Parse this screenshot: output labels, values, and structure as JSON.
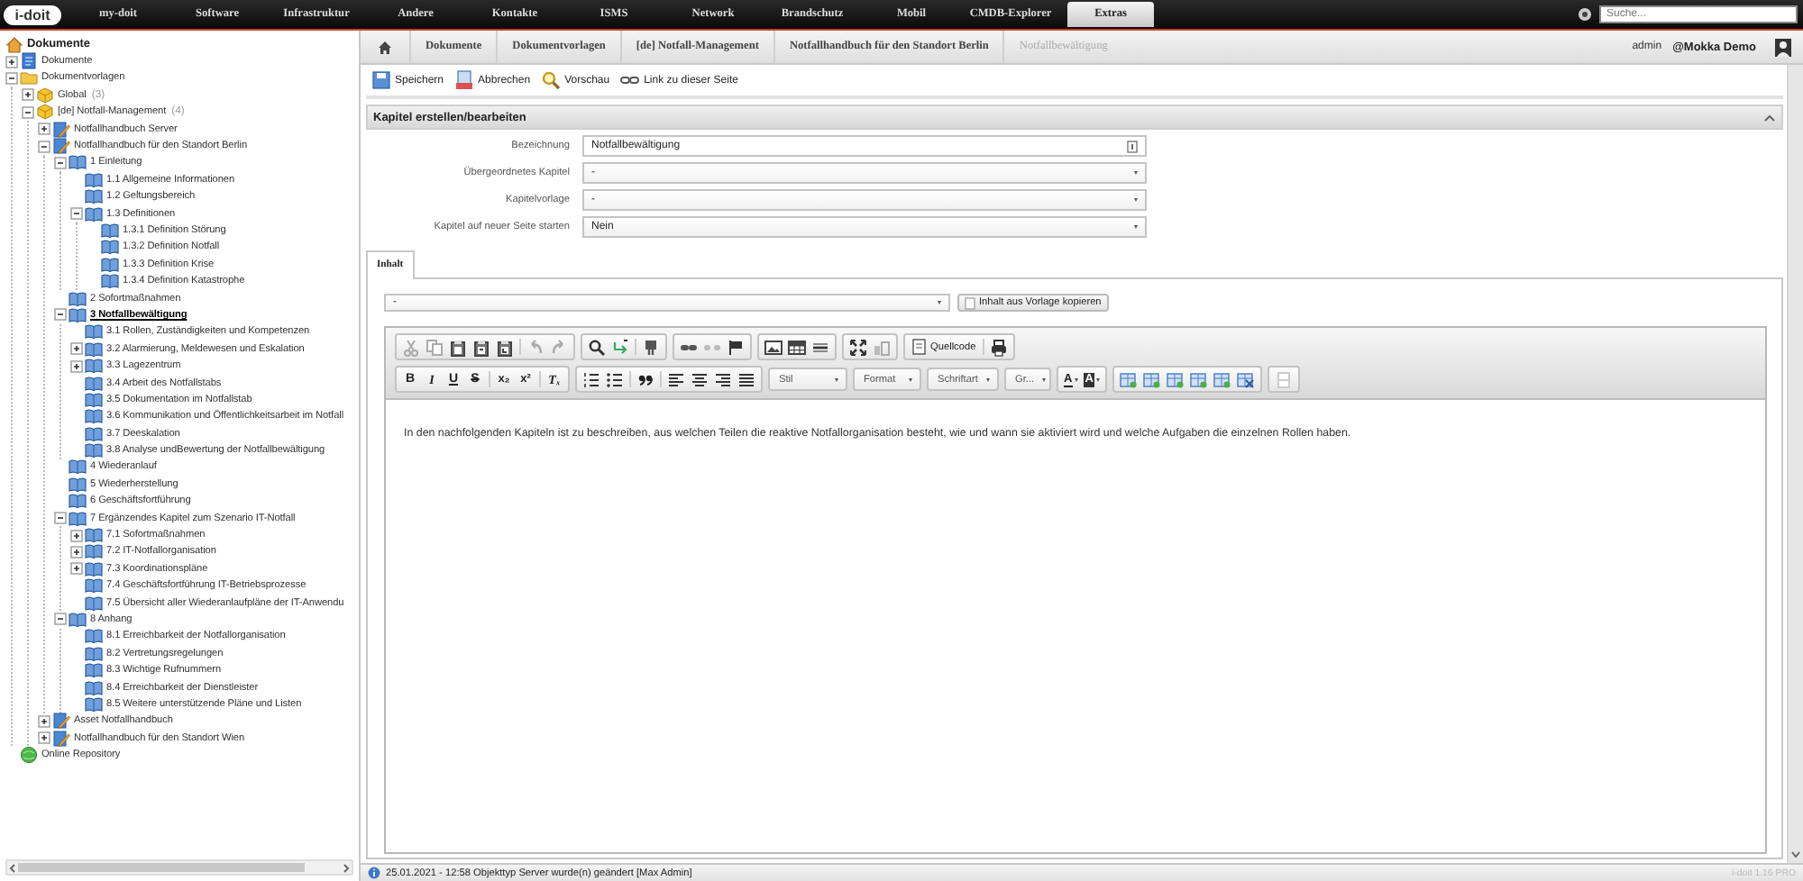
{
  "nav": {
    "logo": "i-doit",
    "items": [
      {
        "label": "my-doit",
        "selected": false
      },
      {
        "label": "Software",
        "selected": false
      },
      {
        "label": "Infrastruktur",
        "selected": false
      },
      {
        "label": "Andere",
        "selected": false
      },
      {
        "label": "Kontakte",
        "selected": false
      },
      {
        "label": "ISMS",
        "selected": false
      },
      {
        "label": "Network",
        "selected": false
      },
      {
        "label": "Brandschutz",
        "selected": false
      },
      {
        "label": "Mobil",
        "selected": false
      },
      {
        "label": "CMDB-Explorer",
        "selected": false
      },
      {
        "label": "Extras",
        "selected": true
      }
    ],
    "search": {
      "placeholder": "Suche..."
    }
  },
  "tree": {
    "items": [
      {
        "label": "Dokumente",
        "kind": "home",
        "selected": false,
        "children": [
          {
            "label": "Dokumente",
            "kind": "document",
            "expanded": false,
            "selected": false
          },
          {
            "label": "Dokumentvorlagen",
            "kind": "folder",
            "expanded": true,
            "selected": false,
            "children": [
              {
                "label": "Global",
                "count": "(3)",
                "kind": "package",
                "expanded": false,
                "selected": false
              },
              {
                "label": "[de] Notfall-Management",
                "count": "(4)",
                "kind": "package",
                "expanded": true,
                "selected": false,
                "children": [
                  {
                    "label": "Notfallhandbuch Server",
                    "kind": "manual",
                    "expanded": false,
                    "selected": false
                  },
                  {
                    "label": "Notfallhandbuch für den Standort Berlin",
                    "kind": "manual",
                    "expanded": true,
                    "selected": false,
                    "children": [
                      {
                        "label": "1 Einleitung",
                        "kind": "chapter",
                        "expanded": true,
                        "selected": false,
                        "children": [
                          {
                            "label": "1.1 Allgemeine Informationen",
                            "kind": "chapter",
                            "selected": false
                          },
                          {
                            "label": "1.2 Geltungsbereich",
                            "kind": "chapter",
                            "selected": false
                          },
                          {
                            "label": "1.3 Definitionen",
                            "kind": "chapter",
                            "expanded": true,
                            "selected": false,
                            "children": [
                              {
                                "label": "1.3.1 Definition Störung",
                                "kind": "chapter",
                                "selected": false
                              },
                              {
                                "label": "1.3.2 Definition Notfall",
                                "kind": "chapter",
                                "selected": false
                              },
                              {
                                "label": "1.3.3 Definition Krise",
                                "kind": "chapter",
                                "selected": false
                              },
                              {
                                "label": "1.3.4 Definition Katastrophe",
                                "kind": "chapter",
                                "selected": false
                              }
                            ]
                          }
                        ]
                      },
                      {
                        "label": "2 Sofortmaßnahmen",
                        "kind": "chapter",
                        "selected": false
                      },
                      {
                        "label": "3 Notfallbewältigung",
                        "kind": "chapter",
                        "expanded": true,
                        "selected": true,
                        "children": [
                          {
                            "label": "3.1 Rollen, Zuständigkeiten und Kompetenzen",
                            "kind": "chapter",
                            "selected": false
                          },
                          {
                            "label": "3.2 Alarmierung, Meldewesen und Eskalation",
                            "kind": "chapter",
                            "expanded": false,
                            "selected": false
                          },
                          {
                            "label": "3.3 Lagezentrum",
                            "kind": "chapter",
                            "expanded": false,
                            "selected": false
                          },
                          {
                            "label": "3.4 Arbeit des Notfallstabs",
                            "kind": "chapter",
                            "selected": false
                          },
                          {
                            "label": "3.5 Dokumentation im Notfallstab",
                            "kind": "chapter",
                            "selected": false
                          },
                          {
                            "label": "3.6 Kommunikation und Öffentlichkeitsarbeit im Notfall",
                            "kind": "chapter",
                            "selected": false
                          },
                          {
                            "label": "3.7 Deeskalation",
                            "kind": "chapter",
                            "selected": false
                          },
                          {
                            "label": "3.8 Analyse undBewertung der Notfallbewältigung",
                            "kind": "chapter",
                            "selected": false
                          }
                        ]
                      },
                      {
                        "label": "4 Wiederanlauf",
                        "kind": "chapter",
                        "selected": false
                      },
                      {
                        "label": "5 Wiederherstellung",
                        "kind": "chapter",
                        "selected": false
                      },
                      {
                        "label": "6 Geschäftsfortführung",
                        "kind": "chapter",
                        "selected": false
                      },
                      {
                        "label": "7 Ergänzendes Kapitel zum Szenario IT-Notfall",
                        "kind": "chapter",
                        "expanded": true,
                        "selected": false,
                        "children": [
                          {
                            "label": "7.1 Sofortmaßnahmen",
                            "kind": "chapter",
                            "expanded": false,
                            "selected": false
                          },
                          {
                            "label": "7.2 IT-Notfallorganisation",
                            "kind": "chapter",
                            "expanded": false,
                            "selected": false
                          },
                          {
                            "label": "7.3 Koordinationspläne",
                            "kind": "chapter",
                            "expanded": false,
                            "selected": false
                          },
                          {
                            "label": "7.4 Geschäftsfortführung IT-Betriebsprozesse",
                            "kind": "chapter",
                            "selected": false
                          },
                          {
                            "label": "7.5 Übersicht aller Wiederanlaufpläne der IT-Anwendu",
                            "kind": "chapter",
                            "selected": false
                          }
                        ]
                      },
                      {
                        "label": "8 Anhang",
                        "kind": "chapter",
                        "expanded": true,
                        "selected": false,
                        "children": [
                          {
                            "label": "8.1 Erreichbarkeit der Notfallorganisation",
                            "kind": "chapter",
                            "selected": false
                          },
                          {
                            "label": "8.2 Vertretungsregelungen",
                            "kind": "chapter",
                            "selected": false
                          },
                          {
                            "label": "8.3 Wichtige Rufnummern",
                            "kind": "chapter",
                            "selected": false
                          },
                          {
                            "label": "8.4 Erreichbarkeit der Dienstleister",
                            "kind": "chapter",
                            "selected": false
                          },
                          {
                            "label": "8.5 Weitere unterstützende Pläne und Listen",
                            "kind": "chapter",
                            "selected": false
                          }
                        ]
                      }
                    ]
                  },
                  {
                    "label": "Asset Notfallhandbuch",
                    "kind": "manual",
                    "expanded": false,
                    "selected": false
                  },
                  {
                    "label": "Notfallhandbuch für den Standort Wien",
                    "kind": "manual",
                    "expanded": false,
                    "selected": false
                  }
                ]
              }
            ]
          },
          {
            "label": "Online Repository",
            "kind": "globe",
            "selected": false
          }
        ]
      }
    ]
  },
  "breadcrumb": {
    "items": [
      {
        "label": "Dokumente",
        "current": false
      },
      {
        "label": "Dokumentvorlagen",
        "current": false
      },
      {
        "label": "[de] Notfall-Management",
        "current": false
      },
      {
        "label": "Notfallhandbuch für den Standort Berlin",
        "current": false
      },
      {
        "label": "Notfallbewältigung",
        "current": true
      }
    ],
    "user": "admin",
    "tenant": "@Mokka Demo"
  },
  "toolbar": [
    {
      "label": "Speichern",
      "kind": "save"
    },
    {
      "label": "Abbrechen",
      "kind": "cancel"
    },
    {
      "label": "Vorschau",
      "kind": "preview"
    },
    {
      "label": "Link zu dieser Seite",
      "kind": "link"
    }
  ],
  "section": {
    "title": "Kapitel erstellen/bearbeiten"
  },
  "form": [
    {
      "label": "Bezeichnung",
      "kind": "text",
      "value": "Notfallbewältigung"
    },
    {
      "label": "Übergeordnetes Kapitel",
      "kind": "select",
      "value": "-"
    },
    {
      "label": "Kapitelvorlage",
      "kind": "select",
      "value": "-"
    },
    {
      "label": "Kapitel auf neuer Seite starten",
      "kind": "select",
      "value": "Nein"
    }
  ],
  "tabs": [
    {
      "label": "Inhalt",
      "selected": true
    }
  ],
  "template": {
    "value": "-",
    "button": "Inhalt aus Vorlage kopieren"
  },
  "editor": {
    "source_button": "Quellcode",
    "format_buttons": [
      {
        "label": "B",
        "kind": "bold"
      },
      {
        "label": "I",
        "kind": "italic"
      },
      {
        "label": "U",
        "kind": "underline"
      },
      {
        "label": "S",
        "kind": "strike"
      },
      {
        "label": "x₂",
        "kind": "plain"
      },
      {
        "label": "x²",
        "kind": "plain"
      },
      {
        "label": "Tₓ",
        "kind": "italic"
      }
    ],
    "combos": [
      "Stil",
      "Format",
      "Schriftart",
      "Gr..."
    ],
    "color_buttons": [
      {
        "label": "A",
        "kind": "text"
      },
      {
        "label": "A",
        "kind": "background"
      }
    ],
    "body": "In den nachfolgenden Kapiteln ist zu beschreiben, aus welchen Teilen die reaktive Notfallorganisation besteht, wie und wann sie aktiviert wird und welche Aufgaben die einzelnen Rollen haben."
  },
  "status": {
    "message": "25.01.2021 - 12:58 Objekttyp Server wurde(n) geändert [Max Admin]",
    "version": "i-doit 1.16 PRO"
  }
}
